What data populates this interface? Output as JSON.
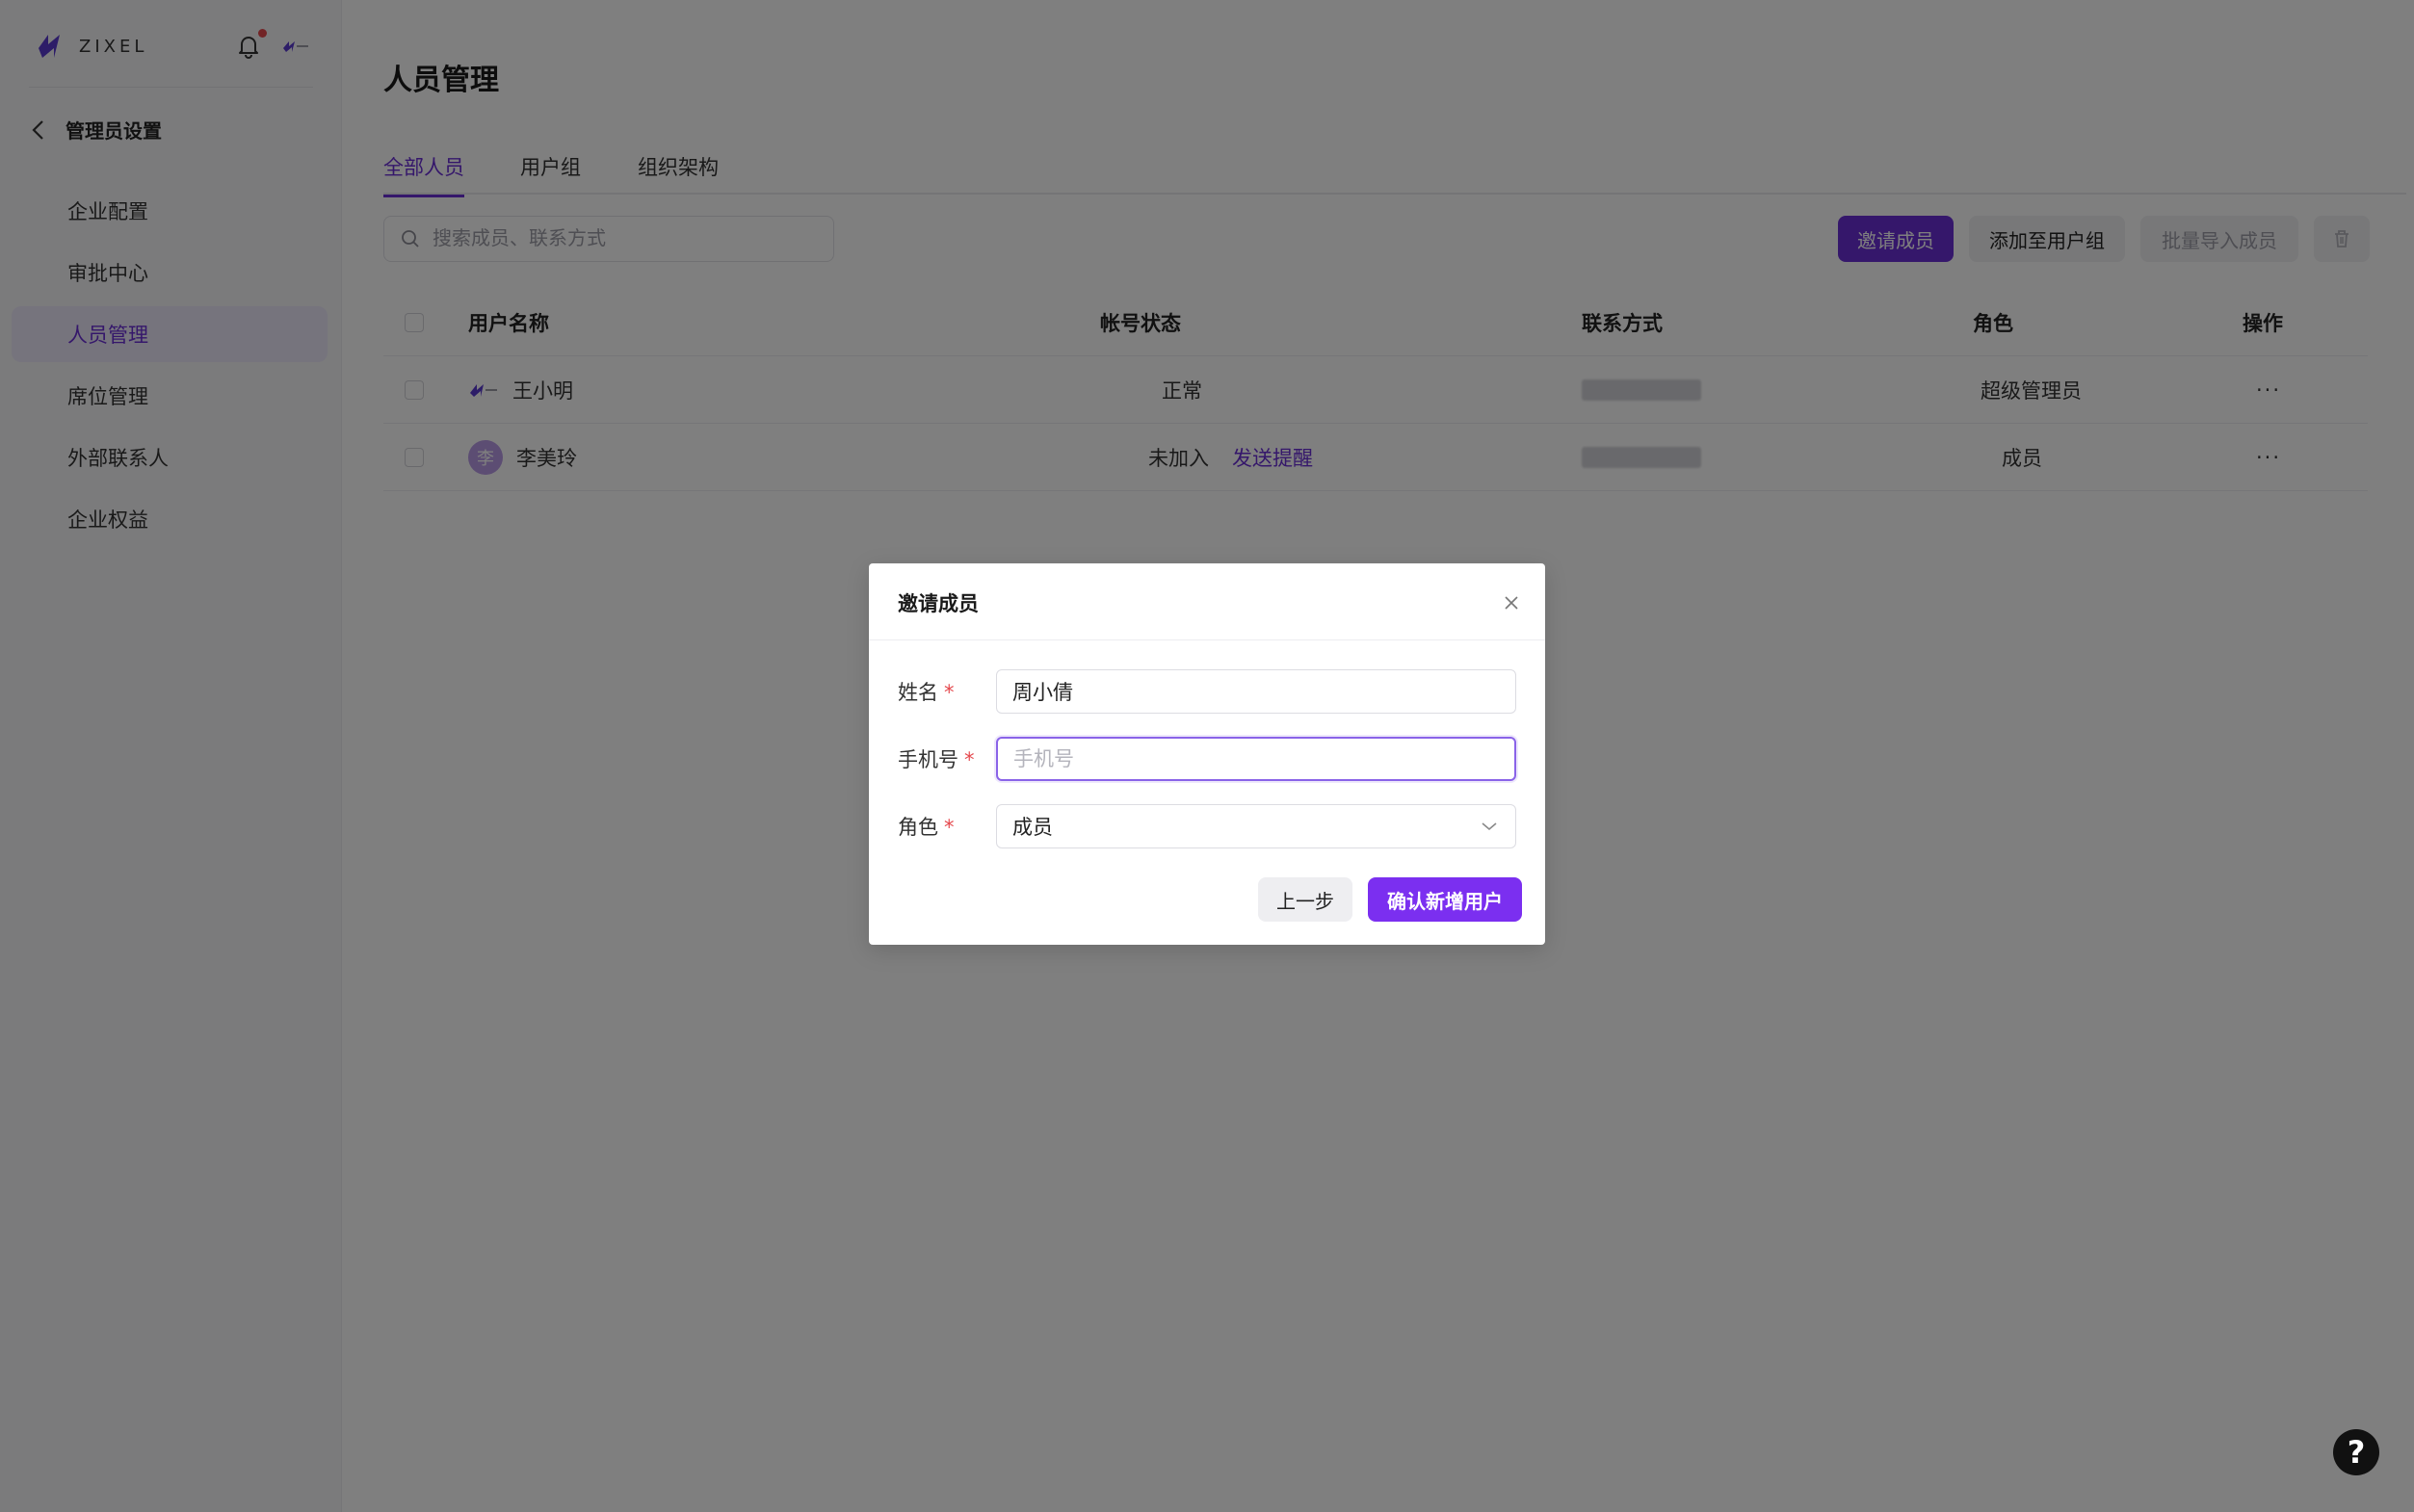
{
  "brand": {
    "name": "ZIXEL"
  },
  "sidebar": {
    "back_label": "管理员设置",
    "items": [
      {
        "label": "企业配置",
        "active": false
      },
      {
        "label": "审批中心",
        "active": false
      },
      {
        "label": "人员管理",
        "active": true
      },
      {
        "label": "席位管理",
        "active": false
      },
      {
        "label": "外部联系人",
        "active": false
      },
      {
        "label": "企业权益",
        "active": false
      }
    ]
  },
  "page": {
    "title": "人员管理",
    "tabs": [
      {
        "label": "全部人员",
        "active": true
      },
      {
        "label": "用户组",
        "active": false
      },
      {
        "label": "组织架构",
        "active": false
      }
    ]
  },
  "toolbar": {
    "search_placeholder": "搜索成员、联系方式",
    "invite_label": "邀请成员",
    "add_group_label": "添加至用户组",
    "import_label": "批量导入成员"
  },
  "table": {
    "headers": {
      "name": "用户名称",
      "status": "帐号状态",
      "contact": "联系方式",
      "role": "角色",
      "ops": "操作"
    },
    "rows": [
      {
        "name": "王小明",
        "avatar": "logo",
        "status": "正常",
        "action": "",
        "role": "超级管理员",
        "ops": "···"
      },
      {
        "name": "李美玲",
        "avatar": "李",
        "status": "未加入",
        "action": "发送提醒",
        "role": "成员",
        "ops": "···"
      }
    ]
  },
  "modal": {
    "title": "邀请成员",
    "name_label": "姓名",
    "name_value": "周小倩",
    "phone_label": "手机号",
    "phone_placeholder": "手机号",
    "role_label": "角色",
    "role_value": "成员",
    "required_mark": "*",
    "prev_label": "上一步",
    "confirm_label": "确认新增用户"
  },
  "help": {
    "label": "?"
  },
  "colors": {
    "accent": "#6b2fd6",
    "confirm": "#7b2ff0",
    "required": "#e5484d",
    "notification_dot": "#e5484d"
  }
}
